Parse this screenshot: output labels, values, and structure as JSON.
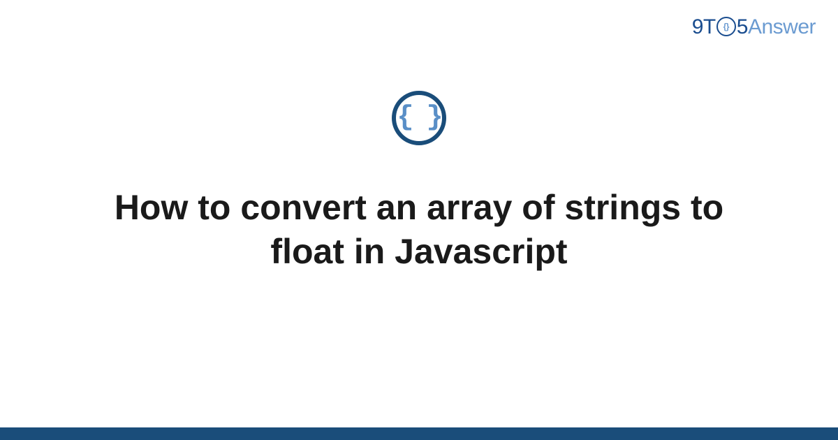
{
  "logo": {
    "part1": "9T",
    "part2": "5",
    "part3": "Answer"
  },
  "icon": {
    "symbol": "{ }",
    "name": "code-braces"
  },
  "title": "How to convert an array of strings to float in Javascript",
  "colors": {
    "primary": "#1a4d7a",
    "accent": "#6b9bd1",
    "text": "#1a1a1a"
  }
}
